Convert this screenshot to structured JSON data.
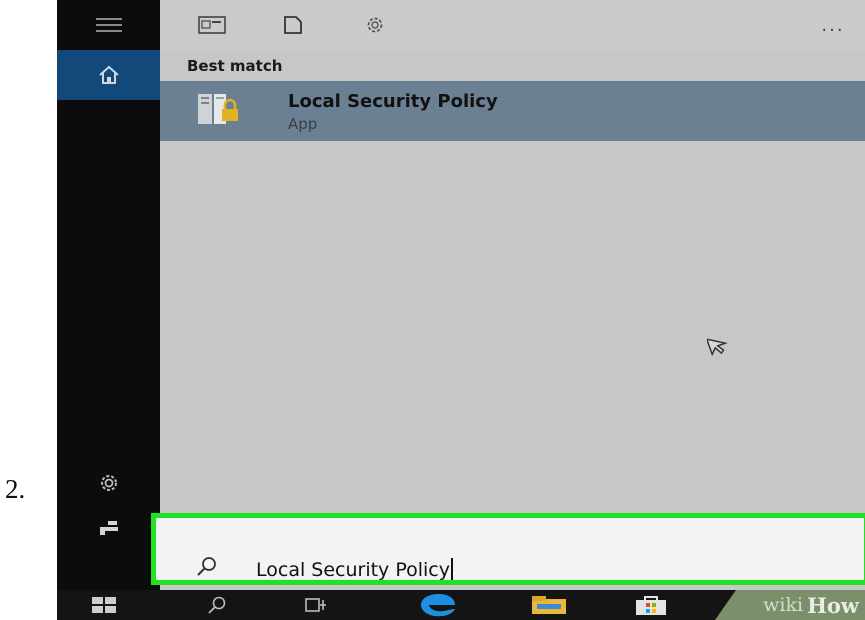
{
  "step": {
    "number": "2."
  },
  "rail": {
    "items": [
      {
        "icon": "hamburger-menu-icon",
        "active": false
      },
      {
        "icon": "home-icon",
        "active": true
      },
      {
        "icon": "settings-gear-icon",
        "active": false
      },
      {
        "icon": "user-feedback-icon",
        "active": false
      }
    ]
  },
  "toolbar": {
    "items": [
      "apps-filter-icon",
      "documents-filter-icon",
      "settings-filter-icon"
    ],
    "more_label": "..."
  },
  "results": {
    "section_label": "Best match",
    "best": {
      "title": "Local Security Policy",
      "subtitle": "App",
      "icon": "security-policy-app-icon"
    }
  },
  "search": {
    "value": "Local Security Policy",
    "icon": "search-icon"
  },
  "taskbar": {
    "items": [
      "windows-start-icon",
      "search-icon",
      "task-view-icon",
      "edge-browser-icon",
      "file-explorer-icon",
      "store-icon"
    ]
  },
  "watermark": {
    "prefix": "wiki",
    "suffix": "How"
  },
  "colors": {
    "accent_green": "#22e022",
    "selected_row": "#6b8092",
    "rail_active": "#13497a"
  }
}
